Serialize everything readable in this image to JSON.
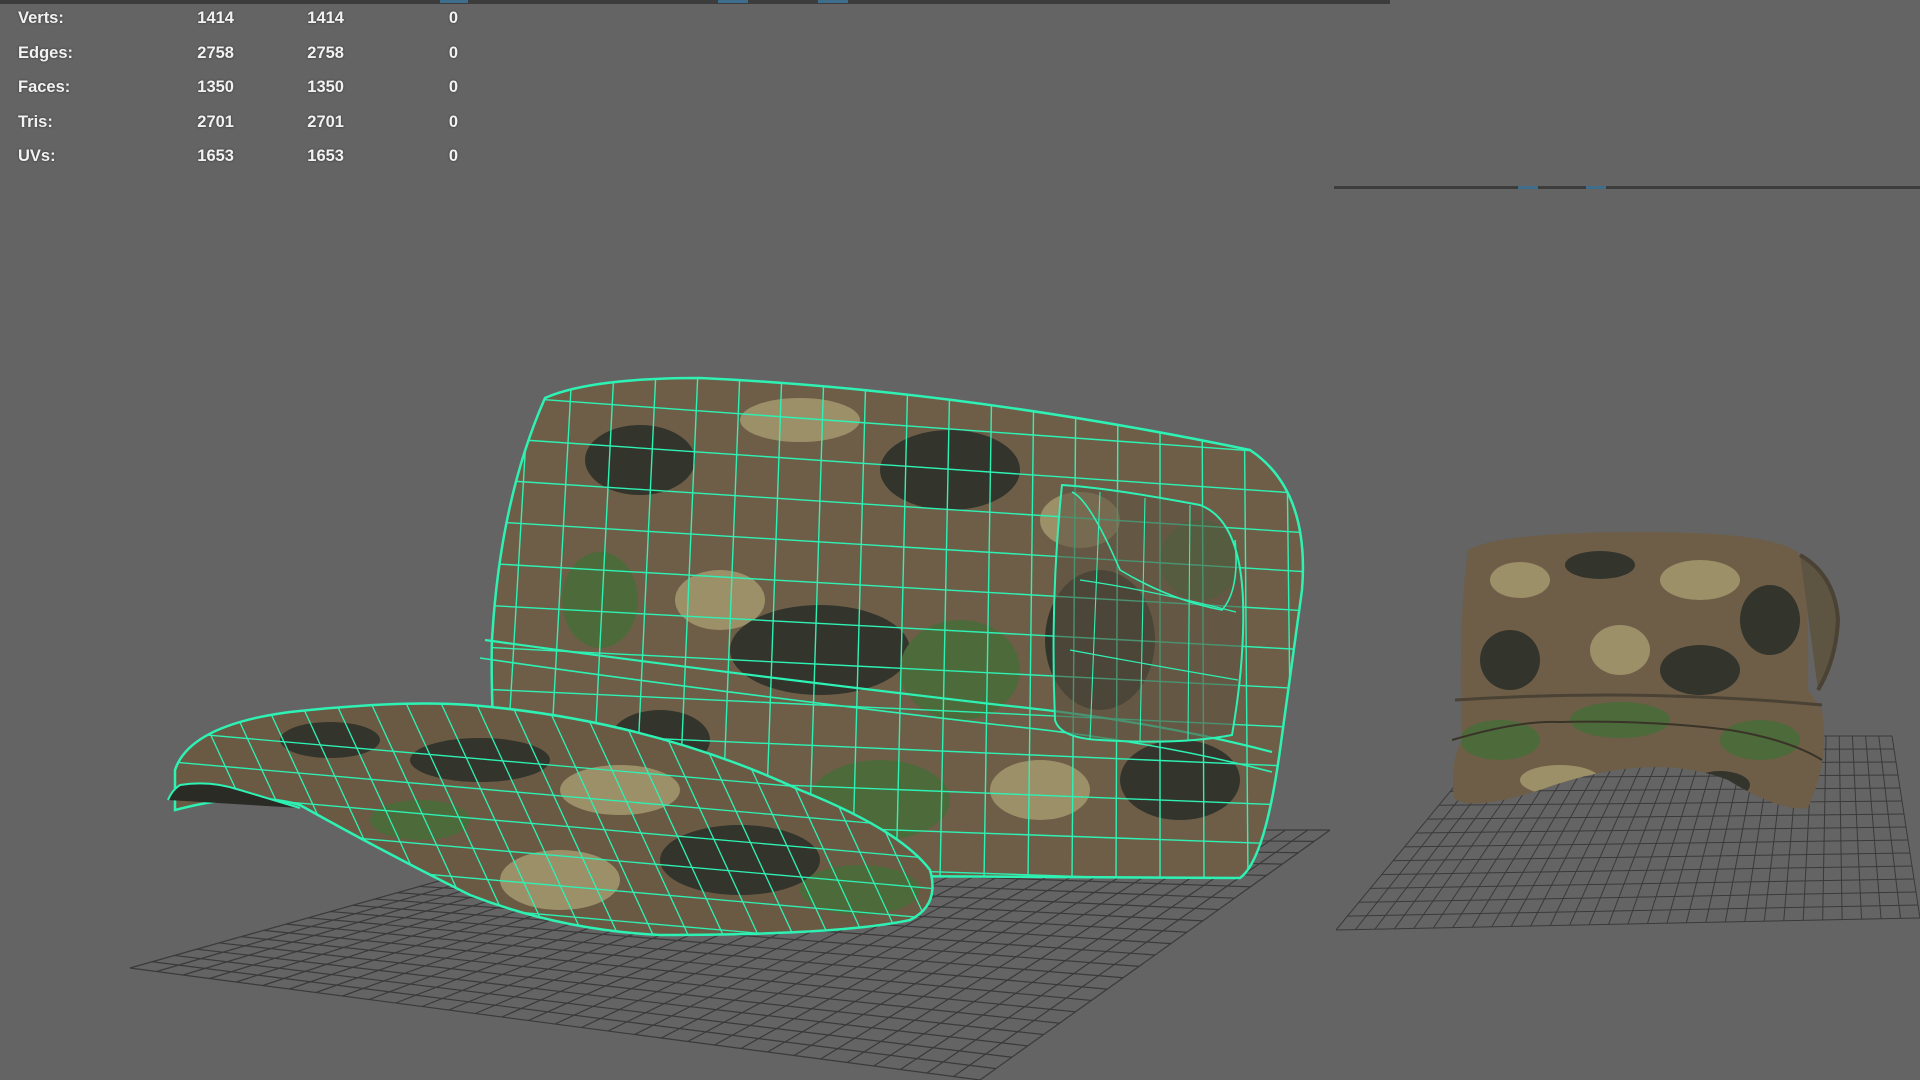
{
  "hud": {
    "rows": [
      {
        "label": "Verts:",
        "object": "1414",
        "selected": "1414",
        "uv": "0"
      },
      {
        "label": "Edges:",
        "object": "2758",
        "selected": "2758",
        "uv": "0"
      },
      {
        "label": "Faces:",
        "object": "1350",
        "selected": "1350",
        "uv": "0"
      },
      {
        "label": "Tris:",
        "object": "2701",
        "selected": "2701",
        "uv": "0"
      },
      {
        "label": "UVs:",
        "object": "1653",
        "selected": "1653",
        "uv": "0"
      }
    ]
  },
  "colors": {
    "viewport_bg": "#646464",
    "wireframe": "#2ef2b4",
    "grid": "#3a3a3a",
    "camo_base": "#6e5e48",
    "camo_dark": "#33342c",
    "camo_green": "#4d6a3a",
    "camo_tan": "#9c9068"
  },
  "icons": {
    "main_model": "cap-3d-mesh",
    "side_model": "cap-3d-mesh"
  }
}
